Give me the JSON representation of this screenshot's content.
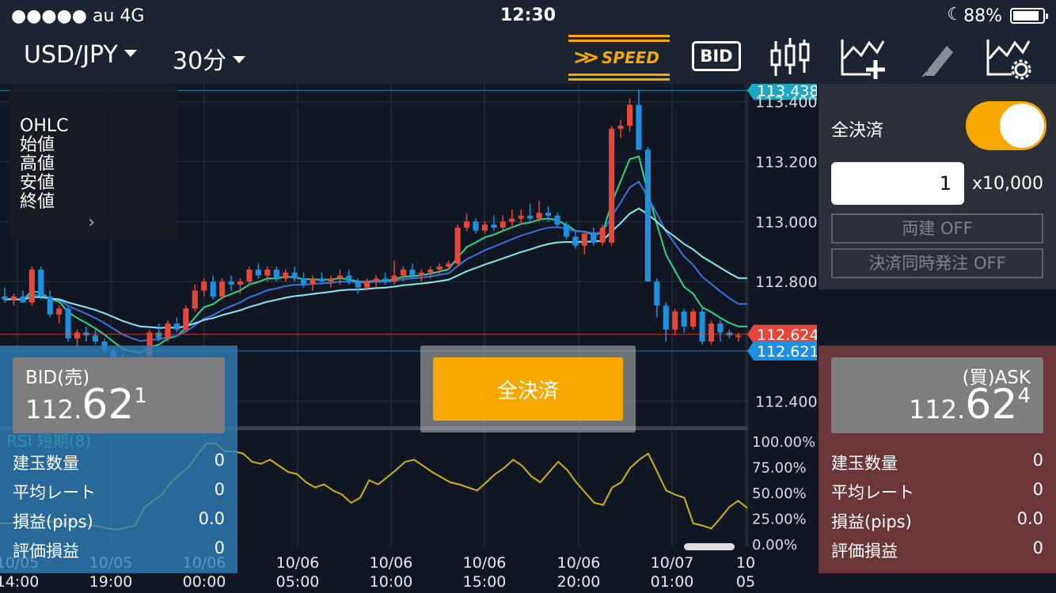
{
  "status_bar": {
    "carrier": "●●●●● au   4G",
    "time": "12:30",
    "battery": "88%",
    "battery_level": 0.88
  },
  "toolbar": {
    "pair": "USD/JPY",
    "timeframe": "30分",
    "speed_label": "SPEED",
    "bid_label": "BID",
    "icons": [
      "speed-order-icon",
      "bid-ask-toggle",
      "candlestick-icon",
      "add-indicator-icon",
      "pencil-icon",
      "chart-settings-icon"
    ]
  },
  "ohlc_box": {
    "title": "OHLC",
    "open": "始値",
    "high": "高値",
    "low": "安値",
    "close": "終値"
  },
  "right_panel": {
    "close_all_label": "全決済",
    "close_all_on": true,
    "quantity": "1",
    "multiplier": "x10,000",
    "hedge": "両建 OFF",
    "simultaneous": "決済同時発注 OFF"
  },
  "bid": {
    "side": "BID(売)",
    "prefix": "112.",
    "big": "62",
    "sup": "1",
    "stats": [
      {
        "label": "建玉数量",
        "value": "0"
      },
      {
        "label": "平均レート",
        "value": "0"
      },
      {
        "label": "損益(pips)",
        "value": "0.0"
      },
      {
        "label": "評価損益",
        "value": "0"
      }
    ]
  },
  "ask": {
    "side": "(買)ASK",
    "prefix": "112.",
    "big": "62",
    "sup": "4",
    "stats": [
      {
        "label": "建玉数量",
        "value": "0"
      },
      {
        "label": "平均レート",
        "value": "0"
      },
      {
        "label": "損益(pips)",
        "value": "0.0"
      },
      {
        "label": "評価損益",
        "value": "0"
      }
    ]
  },
  "close_all_button": "全決済",
  "chart_data": {
    "type": "candlestick",
    "y_range": [
      112.32,
      113.46
    ],
    "y_ticks": [
      {
        "value": 113.4,
        "label": "113.400"
      },
      {
        "value": 113.2,
        "label": "113.200"
      },
      {
        "value": 113.0,
        "label": "113.000"
      },
      {
        "value": 112.8,
        "label": "112.800"
      },
      {
        "value": 112.4,
        "label": "112.400"
      }
    ],
    "price_lines": [
      {
        "value": 113.438,
        "label": "113.438",
        "color": "#1fa6c0"
      },
      {
        "value": 112.624,
        "label": "112.624",
        "color": "#e5473a"
      },
      {
        "value": 112.621,
        "label": "112.621",
        "color": "#1f8fe0"
      }
    ],
    "x_labels": [
      {
        "date": "10/05",
        "time": "14:00"
      },
      {
        "date": "10/05",
        "time": "19:00"
      },
      {
        "date": "10/06",
        "time": "00:00"
      },
      {
        "date": "10/06",
        "time": "05:00"
      },
      {
        "date": "10/06",
        "time": "10:00"
      },
      {
        "date": "10/06",
        "time": "15:00"
      },
      {
        "date": "10/06",
        "time": "20:00"
      },
      {
        "date": "10/07",
        "time": "01:00"
      },
      {
        "date": "10",
        "time": "05"
      }
    ],
    "candles": [
      [
        112.75,
        112.78,
        112.73,
        112.74
      ],
      [
        112.74,
        112.76,
        112.72,
        112.75
      ],
      [
        112.75,
        112.77,
        112.73,
        112.73
      ],
      [
        112.73,
        112.85,
        112.72,
        112.84
      ],
      [
        112.84,
        112.85,
        112.74,
        112.75
      ],
      [
        112.75,
        112.77,
        112.68,
        112.69
      ],
      [
        112.69,
        112.72,
        112.66,
        112.71
      ],
      [
        112.71,
        112.72,
        112.6,
        112.61
      ],
      [
        112.61,
        112.64,
        112.58,
        112.63
      ],
      [
        112.63,
        112.65,
        112.6,
        112.62
      ],
      [
        112.62,
        112.64,
        112.59,
        112.6
      ],
      [
        112.6,
        112.61,
        112.56,
        112.57
      ],
      [
        112.57,
        112.58,
        112.53,
        112.54
      ],
      [
        112.54,
        112.56,
        112.5,
        112.52
      ],
      [
        112.52,
        112.55,
        112.49,
        112.54
      ],
      [
        112.54,
        112.57,
        112.52,
        112.55
      ],
      [
        112.55,
        112.64,
        112.54,
        112.63
      ],
      [
        112.63,
        112.66,
        112.6,
        112.61
      ],
      [
        112.61,
        112.67,
        112.6,
        112.66
      ],
      [
        112.66,
        112.68,
        112.63,
        112.64
      ],
      [
        112.64,
        112.72,
        112.63,
        112.71
      ],
      [
        112.71,
        112.79,
        112.7,
        112.77
      ],
      [
        112.77,
        112.81,
        112.75,
        112.8
      ],
      [
        112.8,
        112.82,
        112.74,
        112.75
      ],
      [
        112.75,
        112.81,
        112.74,
        112.8
      ],
      [
        112.8,
        112.82,
        112.77,
        112.79
      ],
      [
        112.79,
        112.81,
        112.76,
        112.8
      ],
      [
        112.8,
        112.85,
        112.79,
        112.84
      ],
      [
        112.84,
        112.86,
        112.81,
        112.82
      ],
      [
        112.82,
        112.85,
        112.8,
        112.84
      ],
      [
        112.84,
        112.85,
        112.8,
        112.81
      ],
      [
        112.81,
        112.84,
        112.8,
        112.83
      ],
      [
        112.83,
        112.85,
        112.8,
        112.81
      ],
      [
        112.81,
        112.83,
        112.78,
        112.79
      ],
      [
        112.79,
        112.82,
        112.77,
        112.81
      ],
      [
        112.81,
        112.83,
        112.79,
        112.8
      ],
      [
        112.8,
        112.82,
        112.78,
        112.81
      ],
      [
        112.81,
        112.84,
        112.79,
        112.82
      ],
      [
        112.82,
        112.84,
        112.79,
        112.8
      ],
      [
        112.8,
        112.81,
        112.76,
        112.78
      ],
      [
        112.78,
        112.81,
        112.77,
        112.8
      ],
      [
        112.8,
        112.82,
        112.78,
        112.81
      ],
      [
        112.81,
        112.83,
        112.79,
        112.8
      ],
      [
        112.8,
        112.87,
        112.79,
        112.82
      ],
      [
        112.82,
        112.85,
        112.8,
        112.84
      ],
      [
        112.84,
        112.86,
        112.81,
        112.82
      ],
      [
        112.82,
        112.84,
        112.8,
        112.83
      ],
      [
        112.83,
        112.85,
        112.81,
        112.84
      ],
      [
        112.84,
        112.86,
        112.82,
        112.85
      ],
      [
        112.85,
        112.87,
        112.84,
        112.86
      ],
      [
        112.86,
        112.99,
        112.85,
        112.98
      ],
      [
        112.98,
        113.03,
        112.97,
        113.0
      ],
      [
        113.0,
        113.01,
        112.96,
        112.97
      ],
      [
        112.97,
        113.0,
        112.96,
        112.99
      ],
      [
        112.99,
        113.02,
        112.97,
        112.98
      ],
      [
        112.98,
        113.02,
        112.97,
        113.0
      ],
      [
        113.0,
        113.04,
        112.98,
        113.01
      ],
      [
        113.01,
        113.04,
        112.99,
        113.02
      ],
      [
        113.02,
        113.06,
        113.0,
        113.01
      ],
      [
        113.01,
        113.07,
        113.0,
        113.03
      ],
      [
        113.03,
        113.05,
        113.0,
        113.02
      ],
      [
        113.02,
        113.03,
        112.98,
        112.99
      ],
      [
        112.99,
        113.0,
        112.94,
        112.95
      ],
      [
        112.95,
        112.97,
        112.91,
        112.92
      ],
      [
        112.92,
        112.97,
        112.89,
        112.96
      ],
      [
        112.96,
        112.98,
        112.92,
        112.93
      ],
      [
        112.93,
        112.99,
        112.92,
        112.98
      ],
      [
        112.93,
        113.32,
        112.92,
        113.31
      ],
      [
        113.31,
        113.34,
        113.28,
        113.32
      ],
      [
        113.32,
        113.41,
        113.3,
        113.39
      ],
      [
        113.39,
        113.44,
        113.24,
        113.24
      ],
      [
        113.24,
        113.25,
        112.8,
        112.8
      ],
      [
        112.8,
        112.81,
        112.68,
        112.72
      ],
      [
        112.72,
        112.73,
        112.6,
        112.64
      ],
      [
        112.64,
        112.71,
        112.62,
        112.7
      ],
      [
        112.7,
        112.71,
        112.63,
        112.65
      ],
      [
        112.65,
        112.71,
        112.64,
        112.7
      ],
      [
        112.7,
        112.71,
        112.59,
        112.6
      ],
      [
        112.6,
        112.67,
        112.59,
        112.66
      ],
      [
        112.66,
        112.67,
        112.6,
        112.63
      ],
      [
        112.63,
        112.64,
        112.61,
        112.62
      ],
      [
        112.62,
        112.63,
        112.6,
        112.62
      ]
    ],
    "rsi": {
      "label": "RSI 短期(8)",
      "ticks": [
        "100.00%",
        "75.00%",
        "50.00%",
        "25.00%",
        "0.00%"
      ],
      "values": [
        20,
        20,
        21,
        30,
        25,
        23,
        21,
        19,
        22,
        21,
        18,
        17,
        15,
        14,
        16,
        18,
        35,
        42,
        48,
        60,
        68,
        75,
        88,
        98,
        98,
        90,
        90,
        88,
        80,
        78,
        82,
        76,
        70,
        68,
        60,
        55,
        58,
        52,
        48,
        40,
        45,
        62,
        58,
        65,
        72,
        80,
        82,
        76,
        70,
        65,
        60,
        58,
        55,
        52,
        60,
        68,
        74,
        82,
        76,
        66,
        60,
        70,
        80,
        72,
        60,
        50,
        40,
        38,
        55,
        60,
        74,
        82,
        88,
        70,
        52,
        48,
        45,
        20,
        18,
        15,
        25,
        36,
        42,
        35
      ]
    }
  }
}
